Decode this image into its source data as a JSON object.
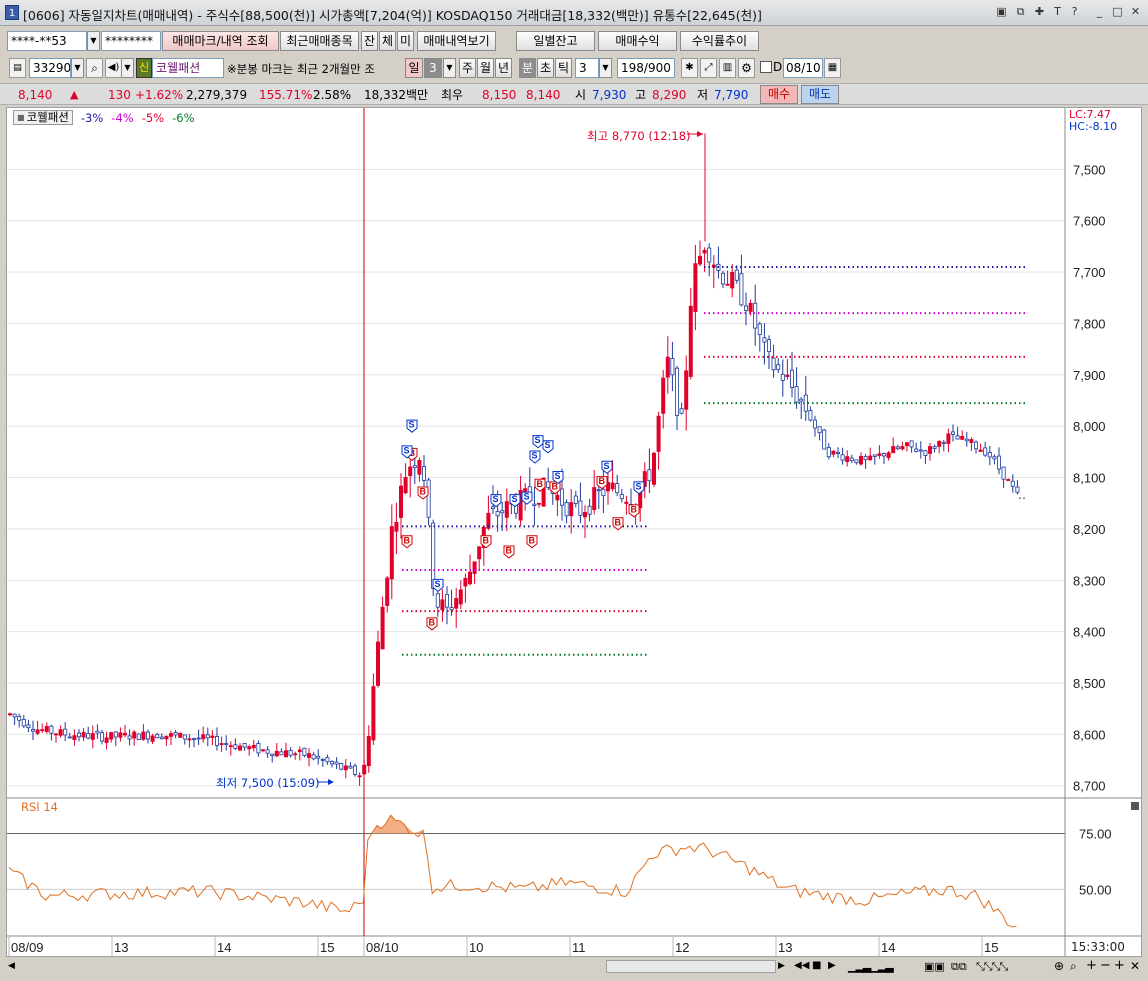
{
  "window": {
    "badge": "1",
    "title": "[0606] 자동일지차트(매매내역) - 주식수[88,500(천)] 시가총액[7,204(억)] KOSDAQ150 거래대금[18,332(백만)] 유통수[22,645(천)]",
    "buttons": [
      "restore",
      "tile",
      "pin",
      "text",
      "help",
      "minimize",
      "maximize",
      "close"
    ]
  },
  "toolbar1": {
    "account": "****-**53",
    "password": "********",
    "mark_button": "매매마크/내역 조회",
    "recent_button": "최근매매종목",
    "tabs": [
      "잔",
      "체",
      "미"
    ],
    "history_button": "매매내역보기",
    "daily_button": "일별잔고",
    "profit_button": "매매수익",
    "rate_button": "수익률추이"
  },
  "toolbar2": {
    "code": "33290",
    "new_badge": "신",
    "stock_name": "코웰패션",
    "notice": "※분봉 마크는 최근 2개월만 조",
    "period_selected": "일",
    "period_num": "3",
    "periods": [
      "주",
      "월",
      "년",
      "분",
      "초",
      "틱"
    ],
    "interval": "3",
    "count": "198/900",
    "d_label": "D",
    "date": "08/10"
  },
  "quote": {
    "price": "8,140",
    "arrow": "▲",
    "change": "130",
    "pct": "+1.62%",
    "volume": "2,279,379",
    "vol_ratio": "155.71%",
    "turnover": "2.58%",
    "amount": "18,332백만",
    "best_label": "최우",
    "best_ask": "8,150",
    "best_bid": "8,140",
    "open_label": "시",
    "open": "7,930",
    "high_label": "고",
    "high": "8,290",
    "low_label": "저",
    "low": "7,790",
    "buy": "매수",
    "sell": "매도"
  },
  "chart": {
    "legend_name": "코웰패션",
    "legend_items": [
      {
        "label": "-3%",
        "color": "#1a1aa0"
      },
      {
        "label": "-4%",
        "color": "#cc00cc"
      },
      {
        "label": "-5%",
        "color": "#e0002a"
      },
      {
        "label": "-6%",
        "color": "#007a2a"
      }
    ],
    "lc": "LC:7.47",
    "hc": "HC:-8.10",
    "high_note": "최고 8,770 (12:18)",
    "low_note": "최저 7,500 (15:09)",
    "rsi_label": "RSI 14",
    "time_readout": "15:33:00",
    "x_labels": [
      "08/09",
      "13",
      "14",
      "15",
      "08/10",
      "10",
      "11",
      "12",
      "13",
      "14",
      "15"
    ],
    "y_labels": [
      "8,700",
      "8,600",
      "8,500",
      "8,400",
      "8,300",
      "8,200",
      "8,100",
      "8,000",
      "7,900",
      "7,800",
      "7,700",
      "7,600",
      "7,500"
    ],
    "rsi_y_labels": [
      "75.00",
      "50.00"
    ],
    "colors": {
      "up": "#e0002a",
      "down": "#1a3aa0",
      "rsi": "#e07020",
      "rsi_fill": "#f0a070"
    }
  },
  "chart_data": {
    "type": "candlestick",
    "title": "",
    "ylim": [
      7480,
      8800
    ],
    "y_ticks": [
      7500,
      7600,
      7700,
      7800,
      7900,
      8000,
      8100,
      8200,
      8300,
      8400,
      8500,
      8600,
      8700
    ],
    "sessions": [
      "08/09",
      "08/10"
    ],
    "x_hours_day1": [
      "13",
      "14",
      "15"
    ],
    "x_hours_day2": [
      "10",
      "11",
      "12",
      "13",
      "14",
      "15"
    ],
    "high": {
      "value": 8770,
      "time": "12:18"
    },
    "low": {
      "value": 7500,
      "time": "15:09"
    },
    "threshold_levels": [
      {
        "name": "-3%",
        "values": [
          8005,
          8510
        ]
      },
      {
        "name": "-4%",
        "values": [
          7920,
          8420
        ]
      },
      {
        "name": "-5%",
        "values": [
          7840,
          8335
        ]
      },
      {
        "name": "-6%",
        "values": [
          7755,
          8245
        ]
      }
    ],
    "trades": {
      "buys": [
        "B",
        "B",
        "B",
        "B",
        "B",
        "B",
        "B",
        "B",
        "B",
        "B",
        "B",
        "B"
      ],
      "sells": [
        "S",
        "S",
        "S",
        "S",
        "S",
        "S",
        "S",
        "S",
        "S",
        "S",
        "S",
        "S"
      ]
    },
    "rsi": {
      "name": "RSI 14",
      "ylim": [
        30,
        90
      ],
      "ticks": [
        75,
        50
      ]
    },
    "last_price": 8060
  }
}
